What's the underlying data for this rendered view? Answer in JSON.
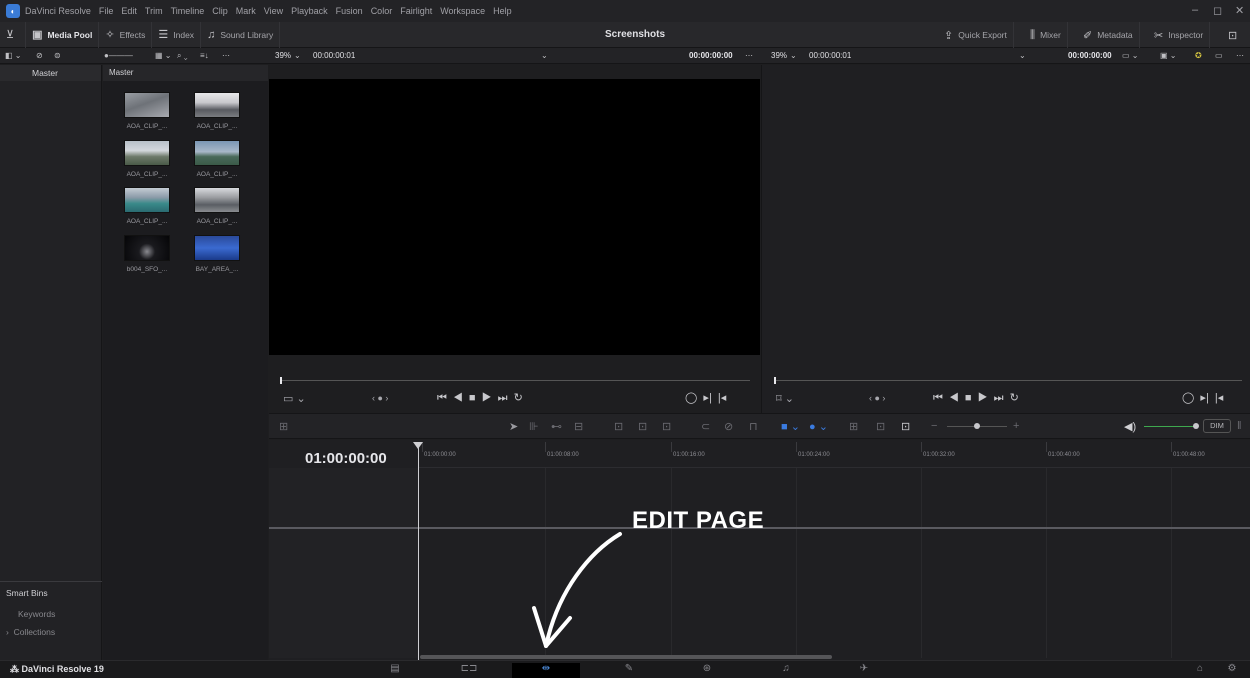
{
  "menubar": {
    "items": [
      "DaVinci Resolve",
      "File",
      "Edit",
      "Trim",
      "Timeline",
      "Clip",
      "Mark",
      "View",
      "Playback",
      "Fusion",
      "Color",
      "Fairlight",
      "Workspace",
      "Help"
    ]
  },
  "toolbar": {
    "media_pool": "Media Pool",
    "effects": "Effects",
    "index": "Index",
    "sound_library": "Sound Library",
    "title": "Screenshots",
    "quick_export": "Quick Export",
    "mixer": "Mixer",
    "metadata": "Metadata",
    "inspector": "Inspector"
  },
  "source_viewer": {
    "zoom": "39%",
    "timecode": "00:00:00:01",
    "right_timecode": "00:00:00:00"
  },
  "timeline_viewer": {
    "zoom": "39%",
    "timecode": "00:00:00:01",
    "right_timecode": "00:00:00:00"
  },
  "bins": {
    "header": "Master",
    "smart_bins_title": "Smart Bins",
    "keywords": "Keywords",
    "collections": "Collections"
  },
  "media_pool": {
    "header": "Master",
    "clips": [
      {
        "name": "AOA_CLIP_..."
      },
      {
        "name": "AOA_CLIP_..."
      },
      {
        "name": "AOA_CLIP_..."
      },
      {
        "name": "AOA_CLIP_..."
      },
      {
        "name": "AOA_CLIP_..."
      },
      {
        "name": "AOA_CLIP_..."
      },
      {
        "name": "b004_SFO_..."
      },
      {
        "name": "BAY_AREA_..."
      }
    ]
  },
  "timeline": {
    "timecode": "01:00:00:00",
    "ruler": [
      "01:00:00:00",
      "01:00:08:00",
      "01:00:16:00",
      "01:00:24:00",
      "01:00:32:00",
      "01:00:40:00",
      "01:00:48:00"
    ],
    "dim_label": "DIM"
  },
  "annotation": {
    "text": "EDIT PAGE"
  },
  "footer": {
    "app_name": "DaVinci Resolve 19"
  }
}
